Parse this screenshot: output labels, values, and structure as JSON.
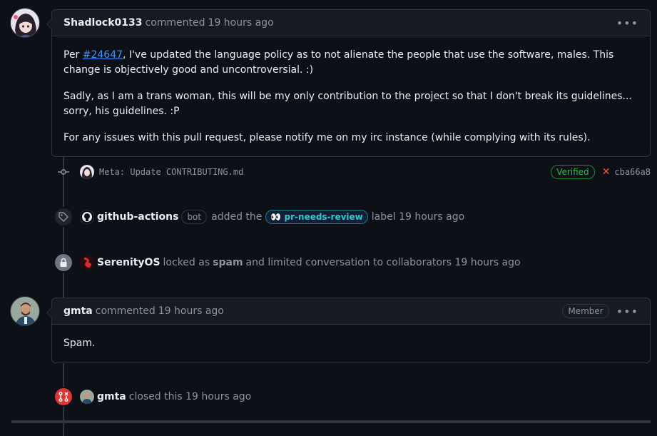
{
  "comment1": {
    "author": "Shadlock0133",
    "action": "commented",
    "time": "19 hours ago",
    "body": {
      "p1_prefix": "Per ",
      "p1_link": "#24647",
      "p1_suffix": ", I've updated the language policy as to not alienate the people that use the software, males. This change is objectively good and uncontroversial. :)",
      "p2": "Sadly, as I am a trans woman, this will be my only contribution to the project so that I don't break its guidelines... sorry, his guidelines. :P",
      "p3": "For any issues with this pull request, please notify me on my irc instance (while complying with its rules)."
    }
  },
  "commit": {
    "message": "Meta: Update CONTRIBUTING.md",
    "verified": "Verified",
    "sha": "cba66a8",
    "status_color": "#f85149"
  },
  "label_event": {
    "actor": "github-actions",
    "bot_badge": "bot",
    "action": "added the",
    "label_icon": "👀",
    "label": "pr-needs-review",
    "suffix": "label 19 hours ago"
  },
  "lock_event": {
    "actor": "SerenityOS",
    "action_prefix": "locked as",
    "reason": "spam",
    "action_suffix": "and limited conversation to collaborators 19 hours ago"
  },
  "comment2": {
    "author": "gmta",
    "action": "commented",
    "time": "19 hours ago",
    "role": "Member",
    "body": "Spam."
  },
  "close_event": {
    "actor": "gmta",
    "action": "closed this 19 hours ago"
  },
  "colors": {
    "background": "#0d1117",
    "header": "#161b22",
    "border": "#30363d",
    "link": "#4493f8",
    "closed": "#da3633",
    "verified": "#3fb950"
  }
}
